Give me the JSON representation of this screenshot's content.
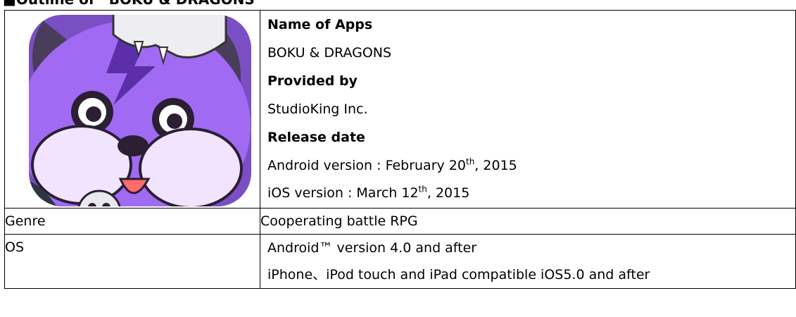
{
  "heading": "■Outline of “BOKU & DRAGONS”",
  "app_icon": {
    "icon": "purple-bear-dragon-game-icon",
    "alt": "BOKU & DRAGONS app icon",
    "colors": {
      "primary": "#9b5cf0",
      "dark": "#3a2a4d",
      "face": "#f2e4ff"
    }
  },
  "info": {
    "name_label": "Name of Apps",
    "name_value": "BOKU & DRAGONS",
    "provider_label": "Provided by",
    "provider_value": "StudioKing Inc.",
    "release_label": "Release date",
    "android_release_prefix": "Android version : February 20",
    "android_release_sup": "th",
    "android_release_suffix": ", 2015",
    "ios_release_prefix": "iOS version : March 12",
    "ios_release_sup": "th",
    "ios_release_suffix": ", 2015"
  },
  "rows": {
    "genre_label": "Genre",
    "genre_value": "Cooperating battle RPG",
    "os_label": "OS",
    "os_android": "Android™ version 4.0 and after",
    "os_ios": "iPhone、iPod touch and  iPad compatible iOS5.0 and after"
  }
}
